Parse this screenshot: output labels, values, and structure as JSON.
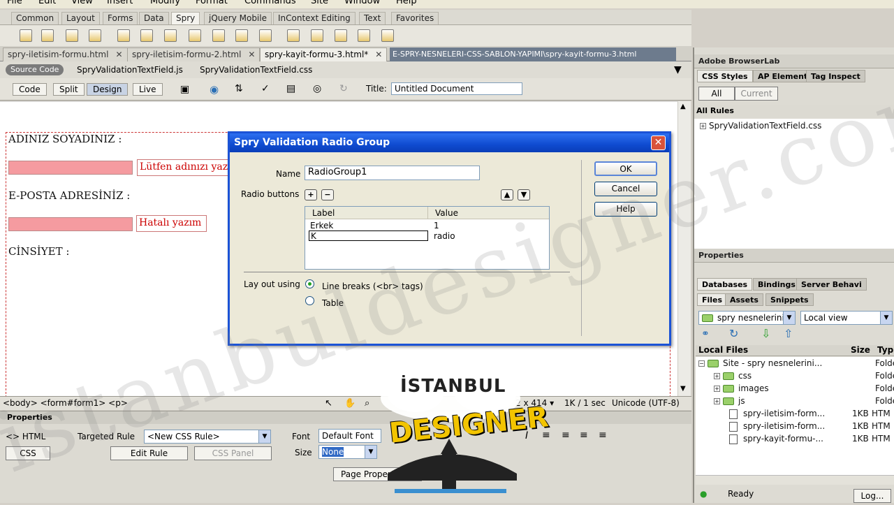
{
  "menu": [
    "File",
    "Edit",
    "View",
    "Insert",
    "Modify",
    "Format",
    "Commands",
    "Site",
    "Window",
    "Help"
  ],
  "insert_tabs": [
    "Common",
    "Layout",
    "Forms",
    "Data",
    "Spry",
    "jQuery Mobile",
    "InContext Editing",
    "Text",
    "Favorites"
  ],
  "insert_active": "Spry",
  "doc_tabs": [
    {
      "label": "spry-iletisim-formu.html",
      "close": "✕"
    },
    {
      "label": "spry-iletisim-formu-2.html",
      "close": "✕"
    },
    {
      "label": "spry-kayit-formu-3.html*",
      "close": "✕"
    }
  ],
  "doc_path": "E-SPRY-NESNELERI-CSS-SABLON-YAPIMI\\spry-kayit-formu-3.html",
  "related": {
    "source": "Source Code",
    "files": [
      "SpryValidationTextField.js",
      "SpryValidationTextField.css"
    ]
  },
  "views": [
    "Code",
    "Split",
    "Design",
    "Live"
  ],
  "title_label": "Title:",
  "title_value": "Untitled Document",
  "form": {
    "name_label": "ADINIZ SOYADINIZ :",
    "name_error": "Lütfen adınızı yaz",
    "email_label": "E-POSTA ADRESİNİZ :",
    "email_error": "Hatalı yazım",
    "gender_label": "CİNSİYET :"
  },
  "status": {
    "path": "<body> <form#form1> <p>",
    "size": "2 x 414 ▾",
    "kb": "1K / 1 sec",
    "enc": "Unicode (UTF-8)"
  },
  "properties": {
    "title": "Properties",
    "html": "<> HTML",
    "css": "CSS",
    "targeted": "Targeted Rule",
    "rule": "<New CSS Rule>",
    "edit_rule": "Edit Rule",
    "css_panel": "CSS Panel",
    "font_label": "Font",
    "font_value": "Default Font",
    "size_label": "Size",
    "size_value": "None",
    "page_props": "Page Properties..."
  },
  "dialog": {
    "title": "Spry Validation Radio Group",
    "name_label": "Name",
    "name_value": "RadioGroup1",
    "radio_label": "Radio buttons",
    "col_label": "Label",
    "col_value": "Value",
    "rows": [
      {
        "label": "Erkek",
        "value": "1"
      },
      {
        "label": "K",
        "value": "radio"
      }
    ],
    "layout_label": "Lay out using",
    "opt1": "Line breaks (<br> tags)",
    "opt2": "Table",
    "ok": "OK",
    "cancel": "Cancel",
    "help": "Help"
  },
  "rpanel": {
    "browserlab": "Adobe BrowserLab",
    "css_tabs": [
      "CSS Styles",
      "AP Element",
      "Tag Inspect"
    ],
    "all": "All",
    "current": "Current",
    "all_rules": "All Rules",
    "rule_file": "SpryValidationTextField.css",
    "properties": "Properties",
    "db_tabs": [
      "Databases",
      "Bindings",
      "Server Behavi"
    ],
    "file_tabs": [
      "Files",
      "Assets",
      "Snippets"
    ],
    "site": "spry nesnelerini",
    "view": "Local view",
    "local_files": "Local Files",
    "size": "Size",
    "type": "Typ",
    "tree": [
      {
        "name": "Site - spry nesnelerini...",
        "size": "",
        "type": "Folde",
        "kind": "site"
      },
      {
        "name": "css",
        "size": "",
        "type": "Folde",
        "kind": "folder"
      },
      {
        "name": "images",
        "size": "",
        "type": "Folde",
        "kind": "folder"
      },
      {
        "name": "js",
        "size": "",
        "type": "Folde",
        "kind": "folder"
      },
      {
        "name": "spry-iletisim-form...",
        "size": "1KB",
        "type": "HTM",
        "kind": "file"
      },
      {
        "name": "spry-iletisim-form...",
        "size": "1KB",
        "type": "HTM",
        "kind": "file"
      },
      {
        "name": "spry-kayit-formu-...",
        "size": "1KB",
        "type": "HTM",
        "kind": "file"
      }
    ],
    "ready": "Ready",
    "log": "Log..."
  },
  "watermark": "istanbuldesigner.com",
  "logo": {
    "top": "İSTANBUL",
    "main": "DESIGNER"
  }
}
